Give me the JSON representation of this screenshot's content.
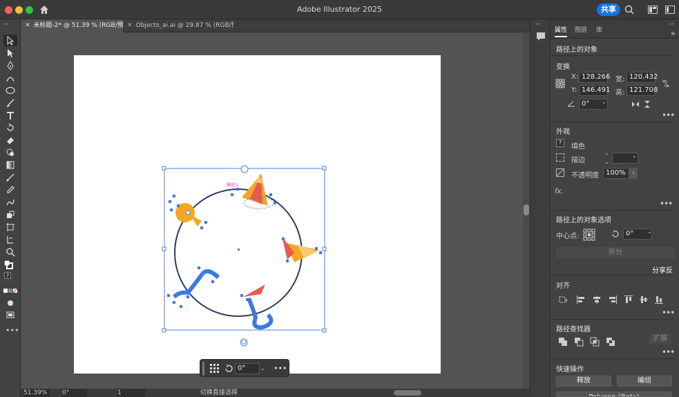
{
  "app": {
    "title": "Adobe Illustrator 2025",
    "share_label": "共享"
  },
  "tabs": [
    {
      "label": "未标题-2* @ 51.39 % (RGB/预览)",
      "active": true
    },
    {
      "label": "Objects_ai.ai @ 29.87 % (RGB/预览)",
      "active": false
    }
  ],
  "panel": {
    "tabs": [
      "属性",
      "图层",
      "库"
    ],
    "selection_title": "路径上的对象",
    "transform": {
      "title": "变换",
      "x_label": "X:",
      "x_value": "128.266",
      "y_label": "Y:",
      "y_value": "146.491",
      "w_label": "宽:",
      "w_value": "120.432",
      "h_label": "高:",
      "h_value": "121.708",
      "angle_value": "0°"
    },
    "appearance": {
      "title": "外观",
      "fill_label": "填色",
      "stroke_label": "描边",
      "opacity_label": "不透明度",
      "opacity_value": "100%",
      "fx_label": "fx."
    },
    "path_options": {
      "title": "路径上的对象选项",
      "center_label": "中心点:",
      "rotate_value": "0°",
      "split_label": "拆分",
      "share_feedback": "分享反"
    },
    "align": {
      "title": "对齐"
    },
    "pathfinder": {
      "title": "路径查找器",
      "expand_label": "扩展"
    },
    "quick_actions": {
      "title": "快速操作",
      "release_label": "释放",
      "group_label": "编组",
      "bottom_label": "Polygon (Beta)"
    }
  },
  "context_bar": {
    "angle_value": "0°",
    "more": "•••"
  },
  "status": {
    "zoom": "51.39%",
    "angle": "0°",
    "page": "1",
    "tool_hint": "切换直接选择"
  },
  "canvas": {
    "artboard_label": "路径上",
    "accent_color": "#1473e6",
    "selection_color": "#4a7fe0"
  }
}
